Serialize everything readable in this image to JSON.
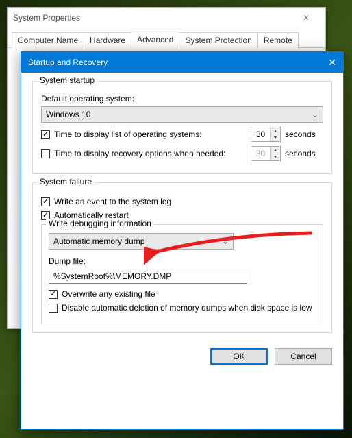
{
  "parent": {
    "title": "System Properties",
    "tabs": [
      "Computer Name",
      "Hardware",
      "Advanced",
      "System Protection",
      "Remote"
    ],
    "active_tab": "Advanced"
  },
  "dialog": {
    "title": "Startup and Recovery",
    "startup": {
      "group_title": "System startup",
      "default_os_label": "Default operating system:",
      "default_os_value": "Windows 10",
      "display_list": {
        "checked": true,
        "label": "Time to display list of operating systems:",
        "value": "30",
        "unit": "seconds"
      },
      "display_recovery": {
        "checked": false,
        "label": "Time to display recovery options when needed:",
        "value": "30",
        "unit": "seconds"
      }
    },
    "failure": {
      "group_title": "System failure",
      "write_event": {
        "checked": true,
        "label": "Write an event to the system log"
      },
      "auto_restart": {
        "checked": true,
        "label": "Automatically restart"
      },
      "debug": {
        "group_title": "Write debugging information",
        "dump_type": "Automatic memory dump",
        "dump_file_label": "Dump file:",
        "dump_file_value": "%SystemRoot%\\MEMORY.DMP",
        "overwrite": {
          "checked": true,
          "label": "Overwrite any existing file"
        },
        "disable_delete": {
          "checked": false,
          "label": "Disable automatic deletion of memory dumps when disk space is low"
        }
      }
    },
    "buttons": {
      "ok": "OK",
      "cancel": "Cancel"
    }
  }
}
